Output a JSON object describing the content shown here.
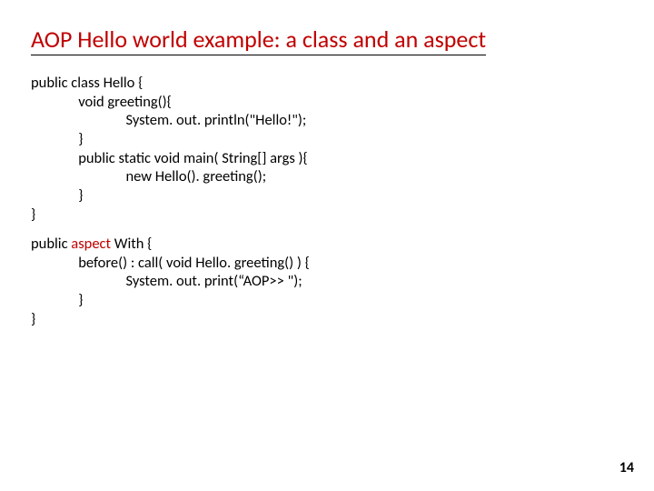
{
  "title": "AOP Hello world example: a class and an aspect",
  "code1": {
    "l0": "public class Hello {",
    "l1": "              void greeting(){",
    "l2": "                            System. out. println(\"Hello!\");",
    "l3": "              }",
    "l4": "              public static void main( String[] args ){",
    "l5": "                            new Hello(). greeting();",
    "l6": "              }",
    "l7": "}"
  },
  "code2": {
    "l0a": "public ",
    "l0b": "aspect",
    "l0c": " With {",
    "l1": "              before() : call( void Hello. greeting() ) {",
    "l2": "                            System. out. print(“AOP>> \");",
    "l3": "              }",
    "l4": "}"
  },
  "page_number": "14"
}
